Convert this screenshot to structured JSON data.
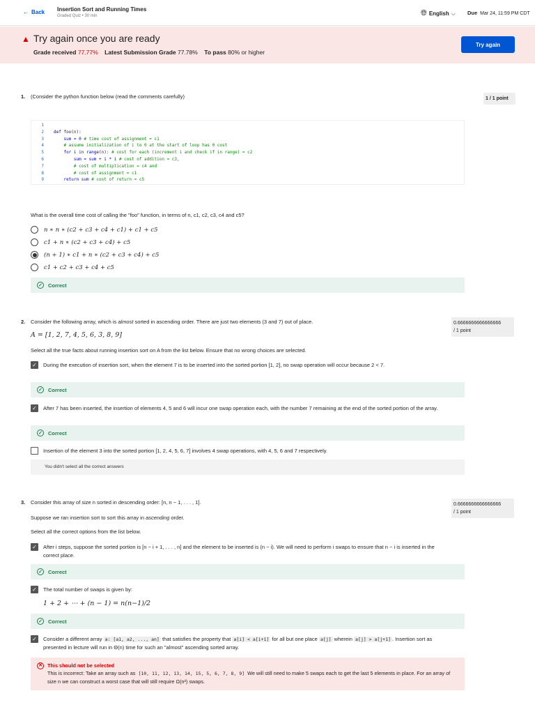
{
  "header": {
    "back": "Back",
    "title": "Insertion Sort and Running Times",
    "subtitle": "Graded Quiz • 30 min",
    "language": "English",
    "due_label": "Due",
    "due_date": "Mar 24, 11:59 PM CDT"
  },
  "banner": {
    "heading": "Try again once you are ready",
    "grade_label": "Grade received",
    "grade": "77.77%",
    "latest_label": "Latest Submission Grade",
    "latest": "77.78%",
    "pass_label": "To pass",
    "pass": "80% or higher",
    "button": "Try again"
  },
  "q1": {
    "num": "1.",
    "prompt": "(Consider the python function below (read the comments carefully)",
    "score": "1 / 1 point",
    "code": [
      {
        "n": "1",
        "parts": []
      },
      {
        "n": "2",
        "parts": [
          [
            "kw",
            "def "
          ],
          [
            "",
            "foo(n):"
          ]
        ]
      },
      {
        "n": "3",
        "parts": [
          [
            "",
            "    "
          ],
          [
            "kw",
            "sum = 0 "
          ],
          [
            "cm",
            "# time cost of assignment = c1"
          ]
        ]
      },
      {
        "n": "4",
        "parts": [
          [
            "",
            "    "
          ],
          [
            "cm",
            "# assume initialization of i to 0 at the start of loop has 0 cost"
          ]
        ]
      },
      {
        "n": "5",
        "parts": [
          [
            "",
            "    "
          ],
          [
            "kw",
            "for i in range"
          ],
          [
            "",
            "(n): "
          ],
          [
            "cm",
            "# cost for each (increment i and check if in range) = c2"
          ]
        ]
      },
      {
        "n": "6",
        "parts": [
          [
            "",
            "        "
          ],
          [
            "kw",
            "sum = sum + i * i "
          ],
          [
            "cm",
            "# cost of addition = c3,"
          ]
        ]
      },
      {
        "n": "7",
        "parts": [
          [
            "",
            "        "
          ],
          [
            "cm",
            "# cost of multiplication = c4 and"
          ]
        ]
      },
      {
        "n": "8",
        "parts": [
          [
            "",
            "        "
          ],
          [
            "cm",
            "# cost of assignment = c1"
          ]
        ]
      },
      {
        "n": "9",
        "parts": [
          [
            "",
            "    "
          ],
          [
            "kw",
            "return sum "
          ],
          [
            "cm",
            "# cost of return = c5"
          ]
        ]
      }
    ],
    "question": "What is the overall time cost of calling the \"foo\" function, in terms of n, c1, c2, c3, c4 and c5?",
    "options": [
      "n ∗ n ∗ (c2 + c3 + c4 + c1) + c1 + c5",
      "c1 + n ∗ (c2 + c3 + c4) + c5",
      "(n + 1) ∗ c1 + n ∗ (c2 + c3 + c4) + c5",
      "c1 + c2 + c3 + c4 + c5"
    ],
    "selected": 2,
    "feedback": "Correct"
  },
  "q2": {
    "num": "2.",
    "prompt_a": "Consider the following array, which is ",
    "prompt_em": "almost",
    "prompt_b": " sorted in ascending order.  There are just two elements (3 and 7) out of place.",
    "score_a": "0.6666666666666666",
    "score_b": "/ 1 point",
    "array": "A = [1, 2, 7, 4, 5, 6, 3, 8, 9]",
    "instruction": "Select all the true facts about running insertion sort on A from the list below. Ensure that no wrong choices are selected.",
    "options": [
      {
        "text": "During the execution of insertion sort, when the element 7 is to be inserted into the sorted portion [1, 2], no swap operation will occur because 2 < 7.",
        "checked": true,
        "feedback": "Correct"
      },
      {
        "text": "After 7 has been inserted, the insertion of elements 4, 5 and 6 will incur one swap operation each, with the number 7 remaining at the end of the sorted portion of the array.",
        "checked": true,
        "feedback": "Correct"
      },
      {
        "text": "Insertion of the element 3 into the sorted portion [1, 2, 4, 5, 6, 7] involves 4 swap operations, with 4, 5, 6 and 7 respectively.",
        "checked": false
      }
    ],
    "missed": "You didn't select all the correct answers"
  },
  "q3": {
    "num": "3.",
    "prompt": "Consider this array of size n sorted in descending order: [n, n − 1, . . . , 1].",
    "score_a": "0.6666666666666666",
    "score_b": "/ 1 point",
    "suppose_a": "Suppose we ran insertion sort to sort this array in ",
    "suppose_em": "ascending",
    "suppose_b": " order.",
    "instruction": "Select all the correct options from the list below.",
    "opt1": "After i steps, suppose the sorted portion is [n − i + 1, . . . , n] and the element to be inserted is (n − i). We will need to perform i swaps to ensure that n − i is inserted in the correct place.",
    "opt2": "The total number of swaps is given by:",
    "formula": "1 + 2 + ⋯ + (n − 1) = n(n−1)/2",
    "opt3_a": "Consider a different array ",
    "opt3_code1": "a: [a1, a2, ..., an]",
    "opt3_b": " that satisfies the property that ",
    "opt3_code2": "a[i] < a[i+1]",
    "opt3_c": " for all but one place ",
    "opt3_code3": "a[j]",
    "opt3_d": " wherein ",
    "opt3_code4": "a[j] > a[j+1]",
    "opt3_e": ". Insertion sort as presented in lecture will run in Θ(n) time for such an \"almost\" ascending sorted array.",
    "feedback": "Correct",
    "error_title": "This should not be selected",
    "error_a": "This is incorrect: Take an array such as ",
    "error_code": "[10, 11, 12, 13, 14, 15, 5, 6, 7, 8, 9]",
    "error_b": " We will still need to make 5 swaps each to get the last 5 elements in place. For an array of size n we can construct a worst case that will still require Ω(n²) swaps."
  }
}
